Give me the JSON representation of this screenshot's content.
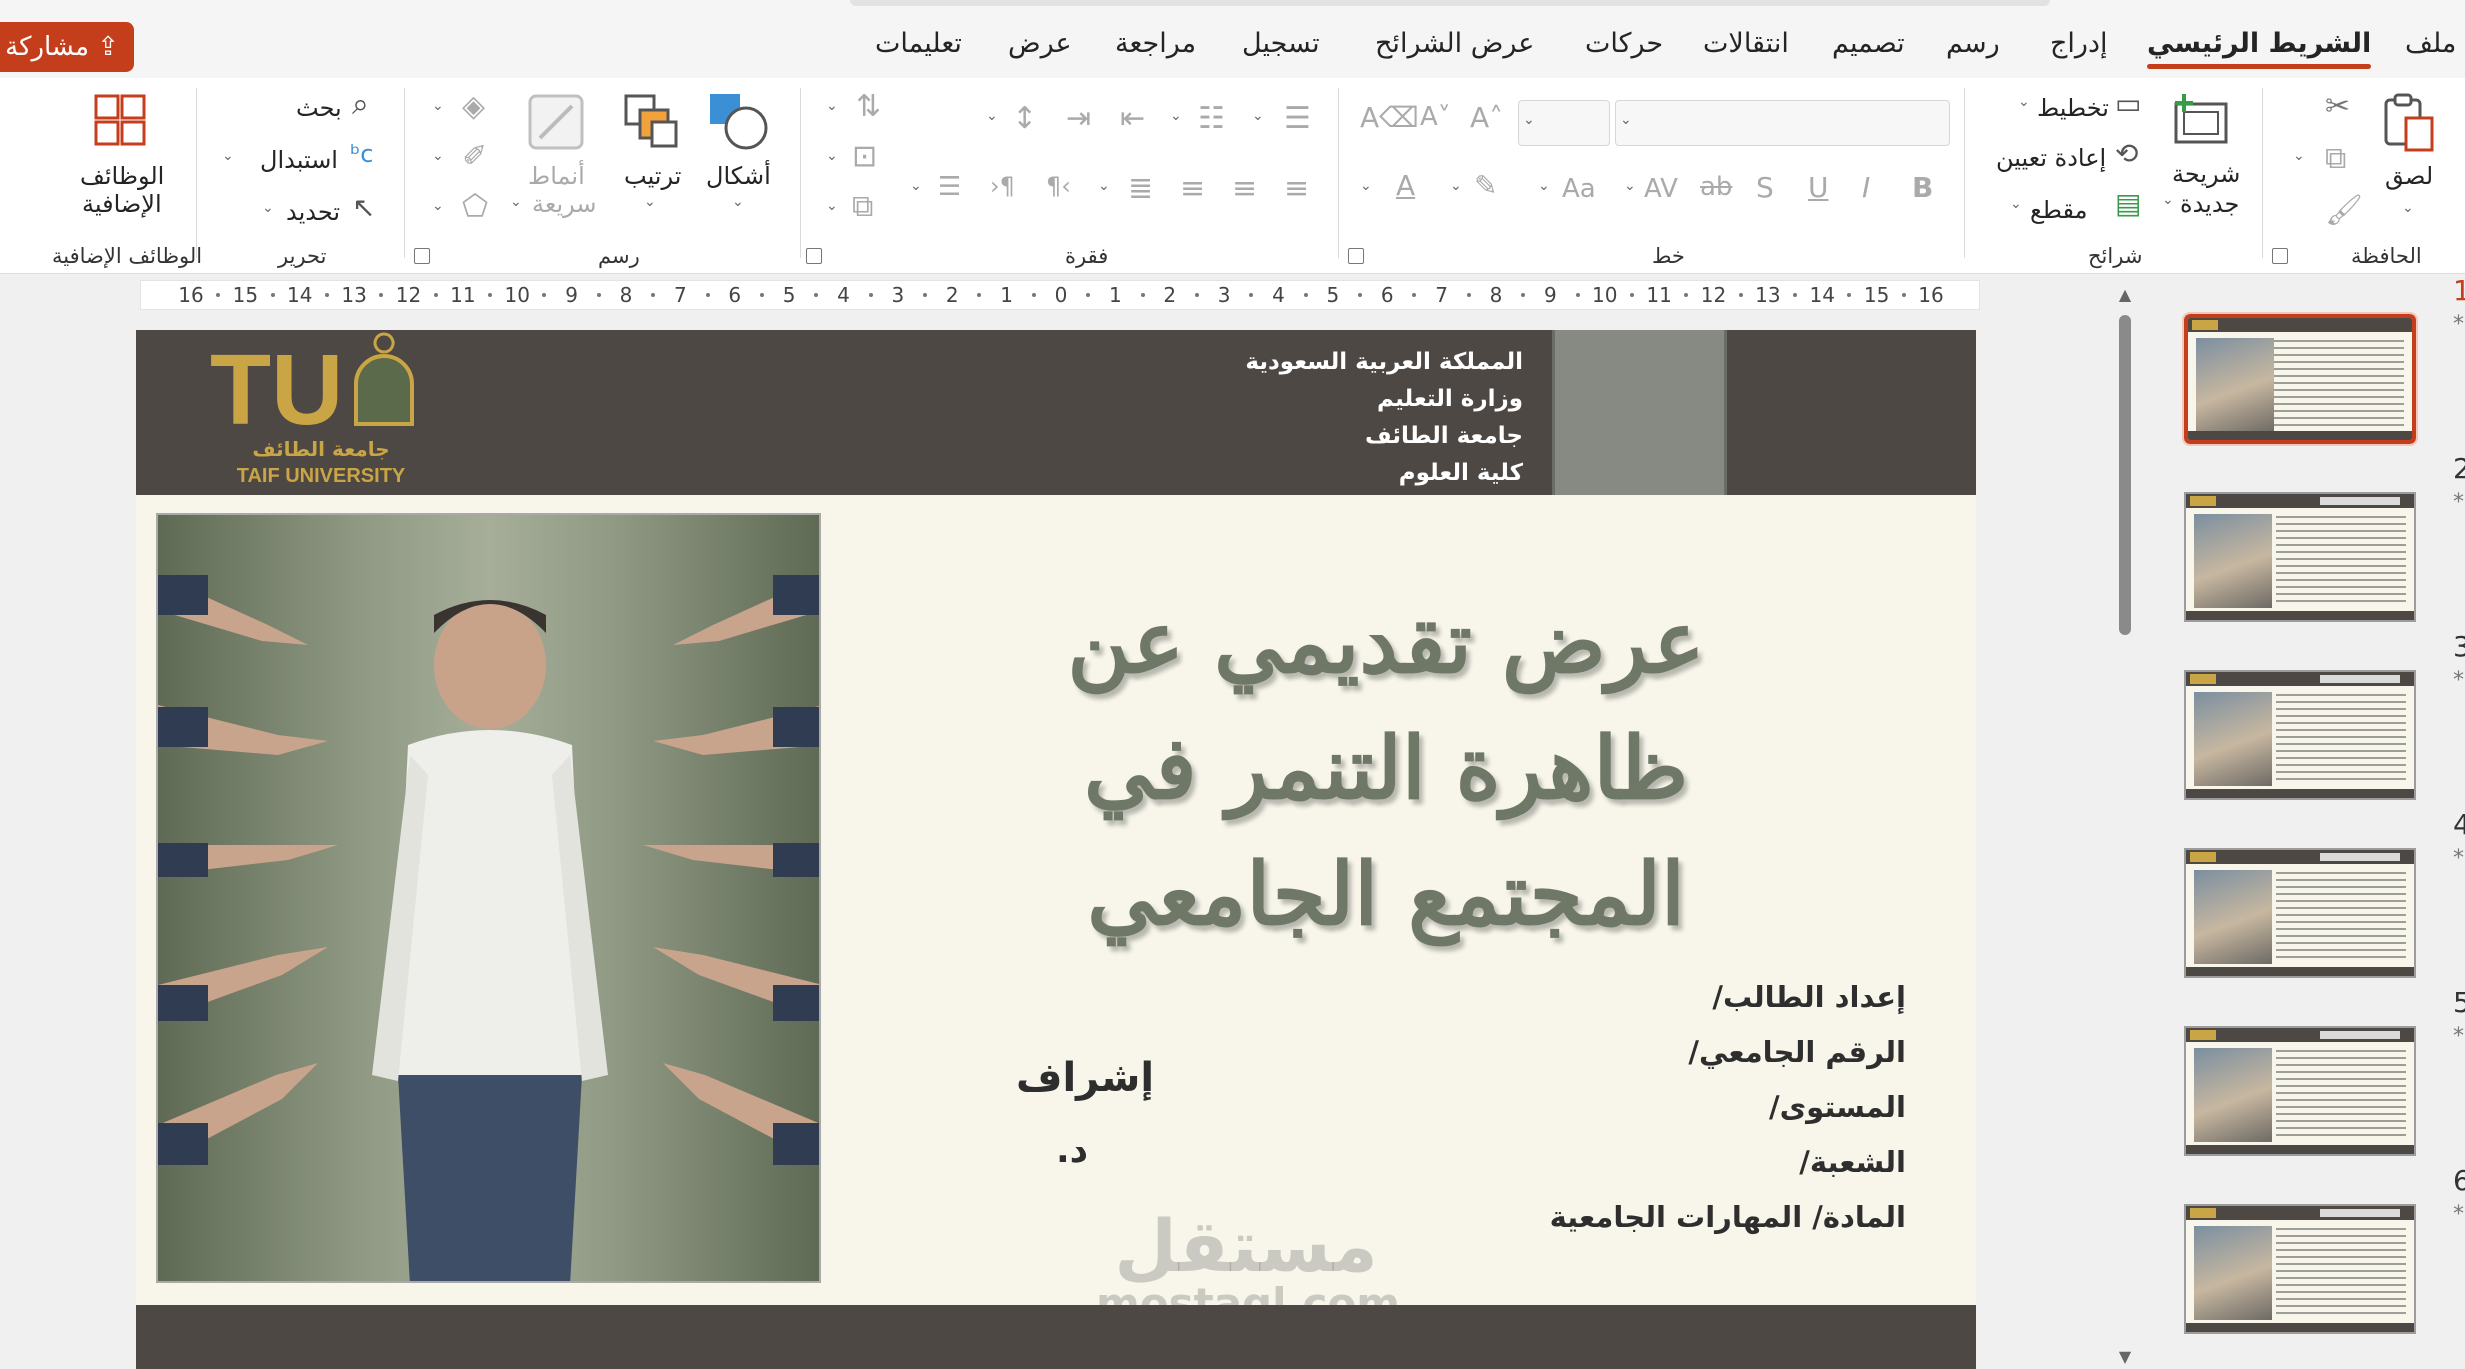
{
  "menubar": {
    "tabs": [
      "ملف",
      "الشريط الرئيسي",
      "إدراج",
      "رسم",
      "تصميم",
      "انتقالات",
      "حركات",
      "عرض الشرائح",
      "تسجيل",
      "مراجعة",
      "عرض",
      "تعليمات"
    ],
    "share_label": "مشاركة"
  },
  "ribbon": {
    "clipboard": {
      "label": "الحافظة",
      "paste": "لصق"
    },
    "slides": {
      "label": "شرائح",
      "new_slide_line1": "شريحة",
      "new_slide_line2": "جديدة",
      "layout": "تخطيط",
      "reset": "إعادة تعيين",
      "section": "مقطع"
    },
    "font": {
      "label": "خط",
      "font_name": "",
      "font_size": "",
      "change_case": "Aa",
      "char_spacing": "AV"
    },
    "paragraph": {
      "label": "فقرة"
    },
    "drawing": {
      "label": "رسم",
      "shapes": "أشكال",
      "arrange": "ترتيب",
      "quick_styles_line1": "أنماط",
      "quick_styles_line2": "سريعة"
    },
    "editing": {
      "label": "تحرير",
      "find": "بحث",
      "replace": "استبدال",
      "select": "تحديد"
    },
    "addins": {
      "label": "الوظائف الإضافية",
      "button_line1": "الوظائف",
      "button_line2": "الإضافية"
    }
  },
  "ruler": {
    "numbers": [
      16,
      15,
      14,
      13,
      12,
      11,
      10,
      9,
      8,
      7,
      6,
      5,
      4,
      3,
      2,
      1,
      0,
      1,
      2,
      3,
      4,
      5,
      6,
      7,
      8,
      9,
      10,
      11,
      12,
      13,
      14,
      15,
      16
    ]
  },
  "slide": {
    "header_lines": [
      "المملكة العربية السعودية",
      "وزارة التعليم",
      "جامعة الطائف",
      "كلية العلوم"
    ],
    "logo": {
      "letters": "TU",
      "arabic": "جامعة الطائف",
      "english": "TAIF UNIVERSITY"
    },
    "title_lines": [
      "عرض تقديمي عن",
      "ظاهرة التنمر في",
      "المجتمع الجامعي"
    ],
    "info_lines": [
      "إعداد الطالب/",
      "الرقم الجامعي/",
      "المستوى/",
      "الشعبة/",
      "المادة/ المهارات الجامعية"
    ],
    "supervisor_label": "إشراف",
    "doctor_label": "د.",
    "watermark_ar": "مستقل",
    "watermark_en": "mostaql.com"
  },
  "thumbnails": {
    "numbers": [
      "1",
      "2",
      "3",
      "4",
      "5",
      "6"
    ],
    "active_index": 0
  },
  "colors": {
    "accent": "#c43e1c",
    "slide_header": "#4e4845",
    "title_text": "#6f7866",
    "logo_gold": "#c9a545"
  }
}
